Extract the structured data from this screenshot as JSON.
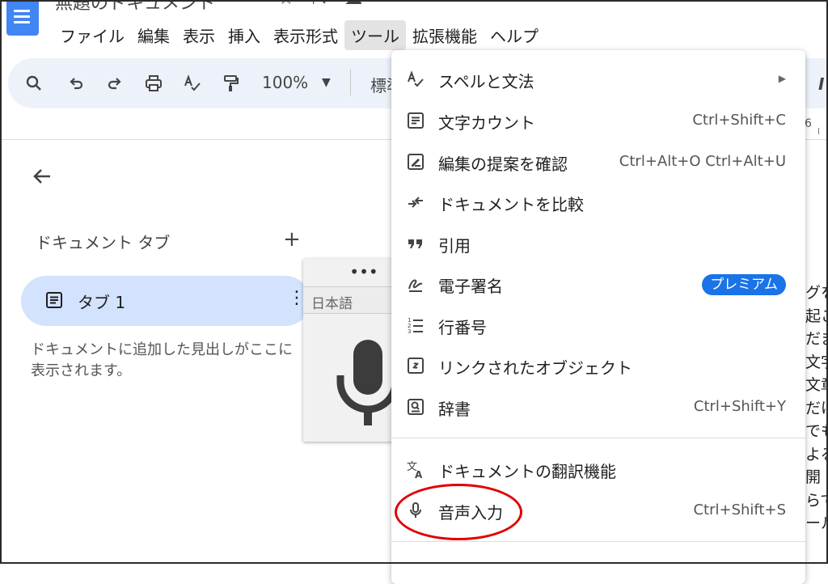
{
  "app": {
    "doc_title": "無題のドキュメント",
    "title_icons": [
      "star-icon",
      "move-to-folder-icon",
      "cloud-saved-icon"
    ]
  },
  "menubar": [
    "ファイル",
    "編集",
    "表示",
    "挿入",
    "表示形式",
    "ツール",
    "拡張機能",
    "ヘルプ"
  ],
  "toolbar": {
    "zoom": "100%",
    "style_partial": "標準"
  },
  "ruler": {
    "label": "6"
  },
  "sidebar": {
    "title": "ドキュメント タブ",
    "add": "+",
    "tab_label": "タブ 1",
    "hint": "ドキュメントに追加した見出しがここに表示されます。"
  },
  "voice": {
    "dots": "•••",
    "language": "日本語"
  },
  "tools_menu": {
    "items": [
      {
        "label": "スペルと文法",
        "shortcut": "",
        "submenu": true,
        "icon": "spellcheck-icon"
      },
      {
        "label": "文字カウント",
        "shortcut": "Ctrl+Shift+C",
        "icon": "word-count-icon"
      },
      {
        "label": "編集の提案を確認",
        "shortcut": "Ctrl+Alt+O Ctrl+Alt+U",
        "icon": "review-edits-icon"
      },
      {
        "label": "ドキュメントを比較",
        "shortcut": "",
        "icon": "compare-icon"
      },
      {
        "label": "引用",
        "shortcut": "",
        "icon": "quote-icon"
      },
      {
        "label": "電子署名",
        "shortcut": "",
        "badge": "プレミアム",
        "icon": "signature-icon"
      },
      {
        "label": "行番号",
        "shortcut": "",
        "icon": "line-numbers-icon"
      },
      {
        "label": "リンクされたオブジェクト",
        "shortcut": "",
        "icon": "linked-objects-icon"
      },
      {
        "label": "辞書",
        "shortcut": "Ctrl+Shift+Y",
        "icon": "dictionary-icon"
      },
      {
        "label": "ドキュメントの翻訳機能",
        "shortcut": "",
        "icon": "translate-icon"
      },
      {
        "label": "音声入力",
        "shortcut": "Ctrl+Shift+S",
        "icon": "microphone-icon"
      }
    ]
  },
  "doc_glimpse": [
    "グを",
    "起こ",
    "だま",
    "文字",
    "文章",
    "だけ",
    "でも",
    "よる",
    "開",
    "らで",
    "ール"
  ],
  "colors": {
    "accent": "#1a73e8",
    "toolbar_bg": "#edf2fa",
    "tab_selected_bg": "#d3e3fd",
    "highlight": "#e00000"
  }
}
